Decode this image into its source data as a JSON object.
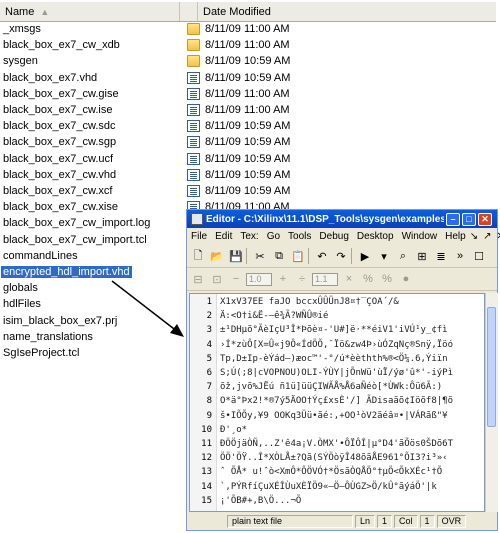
{
  "file_list": {
    "columns": {
      "name": "Name",
      "date": "Date Modified"
    },
    "rows": [
      {
        "name": "_xmsgs",
        "date": "8/11/09 11:00 AM",
        "icon": "folder-icon"
      },
      {
        "name": "black_box_ex7_cw_xdb",
        "date": "8/11/09 11:00 AM",
        "icon": "folder-icon"
      },
      {
        "name": "sysgen",
        "date": "8/11/09 10:59 AM",
        "icon": "folder-icon"
      },
      {
        "name": "black_box_ex7.vhd",
        "date": "8/11/09 10:59 AM",
        "icon": "file-icon"
      },
      {
        "name": "black_box_ex7_cw.gise",
        "date": "8/11/09 11:00 AM",
        "icon": "file-icon"
      },
      {
        "name": "black_box_ex7_cw.ise",
        "date": "8/11/09 11:00 AM",
        "icon": "file-icon"
      },
      {
        "name": "black_box_ex7_cw.sdc",
        "date": "8/11/09 10:59 AM",
        "icon": "file-icon"
      },
      {
        "name": "black_box_ex7_cw.sgp",
        "date": "8/11/09 10:59 AM",
        "icon": "file-icon"
      },
      {
        "name": "black_box_ex7_cw.ucf",
        "date": "8/11/09 10:59 AM",
        "icon": "file-icon"
      },
      {
        "name": "black_box_ex7_cw.vhd",
        "date": "8/11/09 10:59 AM",
        "icon": "file-icon"
      },
      {
        "name": "black_box_ex7_cw.xcf",
        "date": "8/11/09 10:59 AM",
        "icon": "file-icon"
      },
      {
        "name": "black_box_ex7_cw.xise",
        "date": "8/11/09 11:00 AM",
        "icon": "file-icon"
      },
      {
        "name": "black_box_ex7_cw_import.log",
        "date": "",
        "icon": ""
      },
      {
        "name": "black_box_ex7_cw_import.tcl",
        "date": "",
        "icon": ""
      },
      {
        "name": "commandLines",
        "date": "",
        "icon": ""
      },
      {
        "name": "encrypted_hdl_import.vhd",
        "date": "",
        "icon": "",
        "selected": true
      },
      {
        "name": "globals",
        "date": "",
        "icon": ""
      },
      {
        "name": "hdlFiles",
        "date": "",
        "icon": ""
      },
      {
        "name": "isim_black_box_ex7.prj",
        "date": "",
        "icon": ""
      },
      {
        "name": "name_translations",
        "date": "",
        "icon": ""
      },
      {
        "name": "SgIseProject.tcl",
        "date": "",
        "icon": ""
      }
    ]
  },
  "editor": {
    "title": "Editor - C:\\Xilinx\\11.1\\DSP_Tools\\sysgen\\examples\\bla...",
    "menu": [
      "File",
      "Edit",
      "Tex:",
      "Go",
      "Tools",
      "Debug",
      "Desktop",
      "Window",
      "Help"
    ],
    "toolbar2": {
      "spin1": "1.0",
      "spin2": "1.1"
    },
    "lines": [
      {
        "n": "1",
        "t": "X1xV37EE    faJO        bccxÛÛÜnJ8¤†‾ÇOA´/&"
      },
      {
        "n": "2",
        "t": "Ä:<O†i&Ë-—ê¾Ã?WÑÛ®ié"
      },
      {
        "n": "3",
        "t": "±¹DHµõ°ÃèIçU³Î*Þõè¤-'U#]ë·**éiV1'iVÚ¹y_¢fì"
      },
      {
        "n": "4",
        "t": "›Í*zùÔ[X=Û«j9Ô«ÍdÖÕ,¯Ïö&zw4Þ›ùÓZqNç®Snÿ,Ïöó"
      },
      {
        "n": "5",
        "t": "Tp,D±Ip-èÝád—)æoc™'-°/ú*èèthth%®<Ö¼.6,Ýiïn"
      },
      {
        "n": "6",
        "t": "S;Ú(;8|cVOPNOU)OLI-ÝÙY|jÕnWü'ùÏ/ýø'û*'-iýPì"
      },
      {
        "n": "7",
        "t": "õž,jvõ%JËú ñ1ü]üüÇIWÃÅ%Å6aÑéò[*ÙWk:Ôü6Ã:)"
      },
      {
        "n": "8",
        "t": "O*ä°Þx2!*®7ý5ÄOO†Ýç£xsÈ'/] ÃDisaãõ¢Iöõf8|¶õ"
      },
      {
        "n": "9",
        "t": "š•IÕÕy,¥9 OOKq3Üü•ãé:,+OO¹òV2ãéâ¤•|VÁRãß\"¥"
      },
      {
        "n": "10",
        "t": "Ð'¸o*"
      },
      {
        "n": "11",
        "t": "ÐÖÖjäÒÑ,..Z'ê4a¡V.ÒMX'•ÔÏÔÎ|µ°D4'ãÕös0ŠDõ6T"
      },
      {
        "n": "12",
        "t": "ÖÖ'ÖŸ..Î*XÒLÅ±?Qã(SÝÖòÿÎ48õãÅE961°ÕI3?i³»‹"
      },
      {
        "n": "13",
        "t": "ˆ ÕÅ* u!ˆò<XmÔ*ÔÖVÓ†*ÖsãÒQÅÖ°†µÖ<ÕkXÉc¹†Õ"
      },
      {
        "n": "14",
        "t": "`,PÝRfíÇuXÉÎÙuXÈÏÖ9«—Ö—ÔÙGZ>Ö/kÛ°ãýáÖ'|k"
      },
      {
        "n": "15",
        "t": "¡'ÕB#+,B\\Ö...¬Õ"
      }
    ],
    "status": {
      "mode": "plain text file",
      "ln_label": "Ln",
      "ln": "1",
      "col_label": "Col",
      "col": "1",
      "ovr": "OVR"
    }
  }
}
